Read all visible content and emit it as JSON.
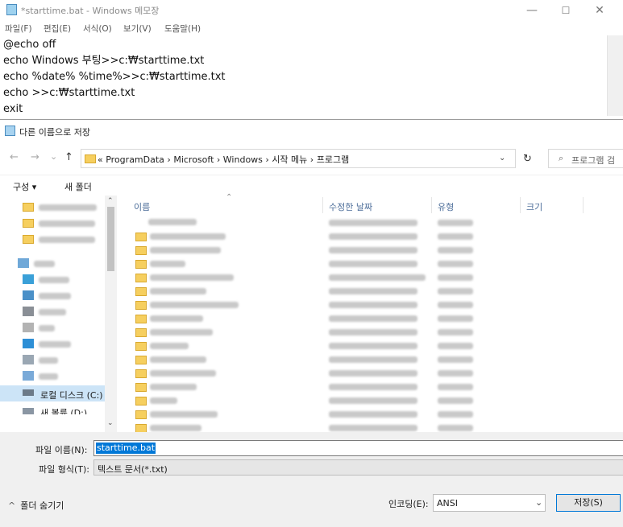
{
  "notepad": {
    "title": "*starttime.bat - Windows 메모장",
    "menu": [
      "파일(F)",
      "편집(E)",
      "서식(O)",
      "보기(V)",
      "도움말(H)"
    ],
    "lines": [
      "@echo off",
      "echo Windows 부팅>>c:₩starttime.txt",
      "echo %date% %time%>>c:₩starttime.txt",
      "echo >>c:₩starttime.txt",
      "exit"
    ],
    "controls": {
      "minimize": "—",
      "maximize": "☐",
      "close": "✕"
    }
  },
  "dialog": {
    "title": "다른 이름으로 저장",
    "nav": {
      "back": "←",
      "forward": "→",
      "recent": "⌄",
      "up": "↑"
    },
    "breadcrumb": [
      "«",
      "ProgramData",
      "›",
      "Microsoft",
      "›",
      "Windows",
      "›",
      "시작 메뉴",
      "›",
      "프로그램"
    ],
    "search_placeholder": "프로그램 검",
    "toolbar": {
      "organize": "구성 ▾",
      "new_folder": "새 폴더"
    },
    "nav_pane": {
      "local_disk": "로컬 디스크 (C:)",
      "new_volume": "새 볼륨 (D:)"
    },
    "columns": {
      "name": "이름",
      "date": "수정한 날짜",
      "type": "유형",
      "size": "크기"
    },
    "filename_label": "파일 이름(N):",
    "filename_value": "starttime.bat",
    "filetype_label": "파일 형식(T):",
    "filetype_value": "텍스트 문서(*.txt)",
    "hide_folders": "폴더 숨기기",
    "encoding_label": "인코딩(E):",
    "encoding_value": "ANSI",
    "save_button": "저장(S)"
  },
  "icons": [
    "notepad-icon",
    "folder-icon",
    "refresh-icon",
    "search-icon",
    "drive-icon",
    "chevron-down-icon"
  ]
}
